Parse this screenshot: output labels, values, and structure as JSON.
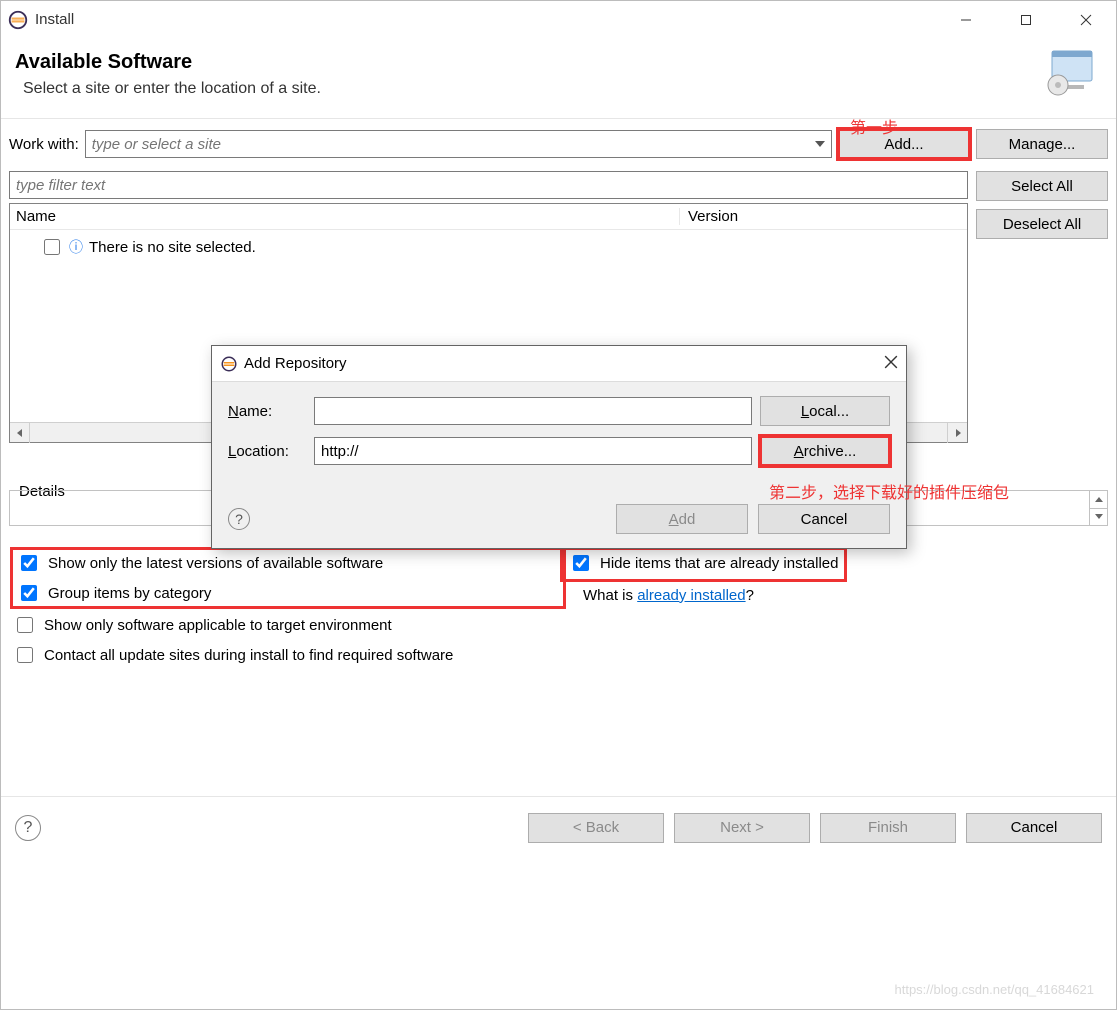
{
  "window": {
    "title": "Install"
  },
  "header": {
    "title": "Available Software",
    "subtitle": "Select a site or enter the location of a site."
  },
  "annotations": {
    "step1": "第一步",
    "step2": "第二步，选择下载好的插件压缩包"
  },
  "workWith": {
    "label": "Work with:",
    "placeholder": "type or select a site",
    "addBtn": "Add...",
    "manageBtn": "Manage..."
  },
  "filter": {
    "placeholder": "type filter text"
  },
  "sideButtons": {
    "selectAll": "Select All",
    "deselectAll": "Deselect All"
  },
  "table": {
    "colName": "Name",
    "colVersion": "Version",
    "emptyMsg": "There is no site selected."
  },
  "details": {
    "label": "Details"
  },
  "checks": {
    "latest": "Show only the latest versions of available software",
    "group": "Group items by category",
    "applicable": "Show only software applicable to target environment",
    "contactAll": "Contact all update sites during install to find required software",
    "hideInstalled": "Hide items that are already installed",
    "whatIsPrefix": "What is ",
    "alreadyInstalledLink": "already installed",
    "qmark": "?"
  },
  "footer": {
    "back": "< Back",
    "next": "Next >",
    "finish": "Finish",
    "cancel": "Cancel"
  },
  "modal": {
    "title": "Add Repository",
    "nameLabel": "Name:",
    "nameValue": "",
    "locationLabel": "Location:",
    "locationValue": "http://",
    "localBtn": "Local...",
    "archiveBtn": "Archive...",
    "addBtn": "Add",
    "cancelBtn": "Cancel"
  },
  "watermark": "https://blog.csdn.net/qq_41684621"
}
